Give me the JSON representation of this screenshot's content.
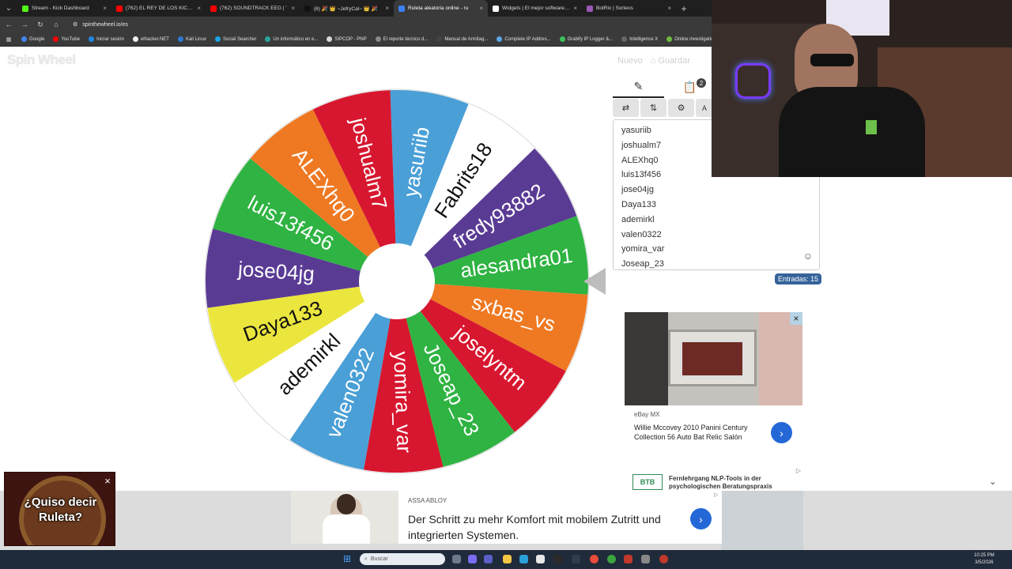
{
  "browser": {
    "tabs": [
      {
        "title": "Stream - Kick Dashboard",
        "color": "#53fc18",
        "active": false
      },
      {
        "title": "(762) EL REY DE LOS KICKBOXER",
        "color": "#ff0000",
        "active": false
      },
      {
        "title": "(762) SOUNDTRACK EEG | '",
        "color": "#ff0000",
        "active": false
      },
      {
        "title": "(6) 🎉 👑 ~JefryCal~ 👑 🎉",
        "color": "#111111",
        "active": false
      },
      {
        "title": "Ruleta aleatoria online - ru",
        "color": "#3b82f6",
        "active": true
      },
      {
        "title": "Widgets | El mejor software pa",
        "color": "#ffffff",
        "active": false
      },
      {
        "title": "BotRix | Sorteos",
        "color": "#9b59b6",
        "active": false
      }
    ],
    "url": "spinthewheel.io/es",
    "bookmarks": [
      {
        "label": "Google",
        "color": "#4285f4"
      },
      {
        "label": "YouTube",
        "color": "#ff0000"
      },
      {
        "label": "Iniciar sesión",
        "color": "#1e88e5"
      },
      {
        "label": "elhacker.NET",
        "color": "#eeeeee"
      },
      {
        "label": "Kali Linux",
        "color": "#2d7ad6"
      },
      {
        "label": "Social Searcher",
        "color": "#1ca3e8"
      },
      {
        "label": "Un informático en e...",
        "color": "#2aa6a0"
      },
      {
        "label": "SIPCOP - PNP",
        "color": "#d8d8d8"
      },
      {
        "label": "El reporte técnico d...",
        "color": "#888888"
      },
      {
        "label": "Manual de Armitag...",
        "color": "#444444"
      },
      {
        "label": "Complete IP Addres...",
        "color": "#5aa7e8"
      },
      {
        "label": "Grabify IP Logger &...",
        "color": "#3cbf5c"
      },
      {
        "label": "Intelligence X",
        "color": "#666666"
      },
      {
        "label": "Online investigation...",
        "color": "#6dbb3c"
      }
    ]
  },
  "app": {
    "logo": "Spin Wheel",
    "new_label": "Nuevo",
    "save_label": "Guardar"
  },
  "wheel": {
    "segments": [
      {
        "name": "yasuriib",
        "color": "#4a9fd6"
      },
      {
        "name": "Fabrits18",
        "color": "#ffffff"
      },
      {
        "name": "fredy93882",
        "color": "#5a3b94"
      },
      {
        "name": "alesandra01",
        "color": "#2fb342"
      },
      {
        "name": "sxbas_vs",
        "color": "#ee7922"
      },
      {
        "name": "joselyntm",
        "color": "#d7172f"
      },
      {
        "name": "Joseap_23",
        "color": "#2fb342"
      },
      {
        "name": "yomira_var",
        "color": "#d7172f"
      },
      {
        "name": "valen0322",
        "color": "#4a9fd6"
      },
      {
        "name": "ademirkl",
        "color": "#ffffff"
      },
      {
        "name": "Daya133",
        "color": "#ebe63d"
      },
      {
        "name": "jose04jg",
        "color": "#5a3b94"
      },
      {
        "name": "luis13f456",
        "color": "#2fb342"
      },
      {
        "name": "ALEXhq0",
        "color": "#ee7922"
      },
      {
        "name": "joshualm7",
        "color": "#d7172f"
      }
    ]
  },
  "panel": {
    "entries": [
      "yasuriib",
      "joshualm7",
      "ALEXhq0",
      "luis13f456",
      "jose04jg",
      "Daya133",
      "ademirkl",
      "valen0322",
      "yomira_var",
      "Joseap_23"
    ],
    "results_badge": "2",
    "toolbar_partial": "A",
    "count_label": "Entradas: 15"
  },
  "ad1": {
    "source": "eBay MX",
    "title": "Willie Mccovey 2010 Panini Century Collection 56 Auto Bat Relic Salón"
  },
  "ad2": {
    "logo": "BTB",
    "text": "Fernlehrgang NLP-Tools in der psychologischen Beratungspraxis"
  },
  "banner": {
    "brand": "ASSA ABLOY",
    "text": "Der Schritt zu mehr Komfort mit mobilem Zutritt und integrierten Systemen."
  },
  "roulette_ad": {
    "text": "¿Quiso decir Ruleta?"
  },
  "taskbar": {
    "search_placeholder": "Buscar",
    "time": "10:25 PM",
    "date": "3/5/2026"
  }
}
